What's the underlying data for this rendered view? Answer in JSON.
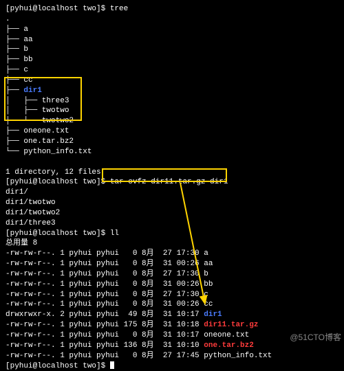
{
  "prompt1": "[pyhui@localhost two]$ ",
  "cmd_tree": "tree",
  "tree_root": ".",
  "tree_lines": {
    "a": "├── a",
    "aa": "├── aa",
    "b": "├── b",
    "bb": "├── bb",
    "c": "├── c",
    "cc": "├── cc",
    "dir1": "├── dir1",
    "three3": "│   ├── three3",
    "twotwo": "│   ├── twotwo",
    "twotwo2": "│   └── twotwo2",
    "oneone": "├── oneone.txt",
    "onetar": "├── one.tar.bz2",
    "pyinfo": "└── python_info.txt"
  },
  "summary": "1 directory, 12 files",
  "prompt2": "[pyhui@localhost two]$ ",
  "cmd_tar": "tar cvfz dir11.tar.gz dir1",
  "tar_out": [
    "dir1/",
    "dir1/twotwo",
    "dir1/twotwo2",
    "dir1/three3"
  ],
  "prompt3": "[pyhui@localhost two]$ ",
  "cmd_ll": "ll",
  "total": "总用量 8",
  "ll_rows": [
    {
      "perm": "-rw-rw-r--.",
      "n": "1",
      "u": "pyhui",
      "g": "pyhui",
      "sz": "  0",
      "m": "8月",
      "d": "27",
      "t": "17:30",
      "name": "a",
      "cls": ""
    },
    {
      "perm": "-rw-rw-r--.",
      "n": "1",
      "u": "pyhui",
      "g": "pyhui",
      "sz": "  0",
      "m": "8月",
      "d": "31",
      "t": "00:26",
      "name": "aa",
      "cls": ""
    },
    {
      "perm": "-rw-rw-r--.",
      "n": "1",
      "u": "pyhui",
      "g": "pyhui",
      "sz": "  0",
      "m": "8月",
      "d": "27",
      "t": "17:30",
      "name": "b",
      "cls": ""
    },
    {
      "perm": "-rw-rw-r--.",
      "n": "1",
      "u": "pyhui",
      "g": "pyhui",
      "sz": "  0",
      "m": "8月",
      "d": "31",
      "t": "00:26",
      "name": "bb",
      "cls": ""
    },
    {
      "perm": "-rw-rw-r--.",
      "n": "1",
      "u": "pyhui",
      "g": "pyhui",
      "sz": "  0",
      "m": "8月",
      "d": "27",
      "t": "17:30",
      "name": "c",
      "cls": ""
    },
    {
      "perm": "-rw-rw-r--.",
      "n": "1",
      "u": "pyhui",
      "g": "pyhui",
      "sz": "  0",
      "m": "8月",
      "d": "31",
      "t": "00:26",
      "name": "cc",
      "cls": ""
    },
    {
      "perm": "drwxrwxr-x.",
      "n": "2",
      "u": "pyhui",
      "g": "pyhui",
      "sz": " 49",
      "m": "8月",
      "d": "31",
      "t": "10:17",
      "name": "dir1",
      "cls": "dir-blue"
    },
    {
      "perm": "-rw-rw-r--.",
      "n": "1",
      "u": "pyhui",
      "g": "pyhui",
      "sz": "175",
      "m": "8月",
      "d": "31",
      "t": "10:18",
      "name": "dir11.tar.gz",
      "cls": "tar-red"
    },
    {
      "perm": "-rw-rw-r--.",
      "n": "1",
      "u": "pyhui",
      "g": "pyhui",
      "sz": "  0",
      "m": "8月",
      "d": "31",
      "t": "10:17",
      "name": "oneone.txt",
      "cls": ""
    },
    {
      "perm": "-rw-rw-r--.",
      "n": "1",
      "u": "pyhui",
      "g": "pyhui",
      "sz": "136",
      "m": "8月",
      "d": "31",
      "t": "10:10",
      "name": "one.tar.bz2",
      "cls": "bz2-red"
    },
    {
      "perm": "-rw-rw-r--.",
      "n": "1",
      "u": "pyhui",
      "g": "pyhui",
      "sz": "  0",
      "m": "8月",
      "d": "27",
      "t": "17:45",
      "name": "python_info.txt",
      "cls": ""
    }
  ],
  "prompt4": "[pyhui@localhost two]$ ",
  "watermark": "@51CTO博客"
}
